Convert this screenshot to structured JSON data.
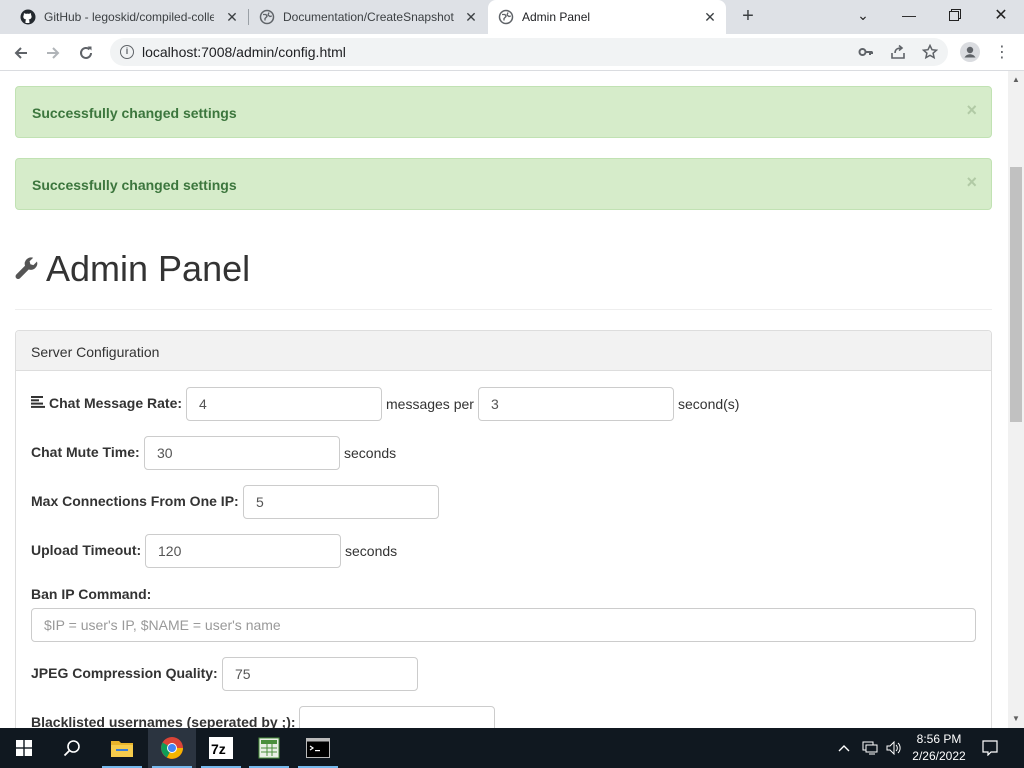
{
  "browser": {
    "tabs": [
      {
        "title": "GitHub - legoskid/compiled-colle",
        "favicon": "github-icon",
        "active": false
      },
      {
        "title": "Documentation/CreateSnapshot",
        "favicon": "globe-icon",
        "active": false
      },
      {
        "title": "Admin Panel",
        "favicon": "globe-icon",
        "active": true
      }
    ],
    "url": "localhost:7008/admin/config.html"
  },
  "alerts": [
    {
      "message": "Successfully changed settings",
      "close": "×"
    },
    {
      "message": "Successfully changed settings",
      "close": "×"
    }
  ],
  "page": {
    "title": "Admin Panel",
    "title_icon": "wrench-icon"
  },
  "panel": {
    "heading": "Server Configuration",
    "chat_rate": {
      "label": "Chat Message Rate:",
      "value1": "4",
      "middle": "messages per",
      "value2": "3",
      "suffix": "second(s)"
    },
    "mute_time": {
      "label": "Chat Mute Time:",
      "value": "30",
      "suffix": "seconds"
    },
    "max_conn": {
      "label": "Max Connections From One IP:",
      "value": "5"
    },
    "upload_timeout": {
      "label": "Upload Timeout:",
      "value": "120",
      "suffix": "seconds"
    },
    "ban_ip": {
      "label": "Ban IP Command:",
      "placeholder": "$IP = user's IP, $NAME = user's name"
    },
    "jpeg_quality": {
      "label": "JPEG Compression Quality:",
      "value": "75"
    },
    "blacklist": {
      "label": "Blacklisted usernames (seperated by ;):",
      "value": ""
    }
  },
  "taskbar": {
    "time": "8:56 PM",
    "date": "2/26/2022"
  }
}
